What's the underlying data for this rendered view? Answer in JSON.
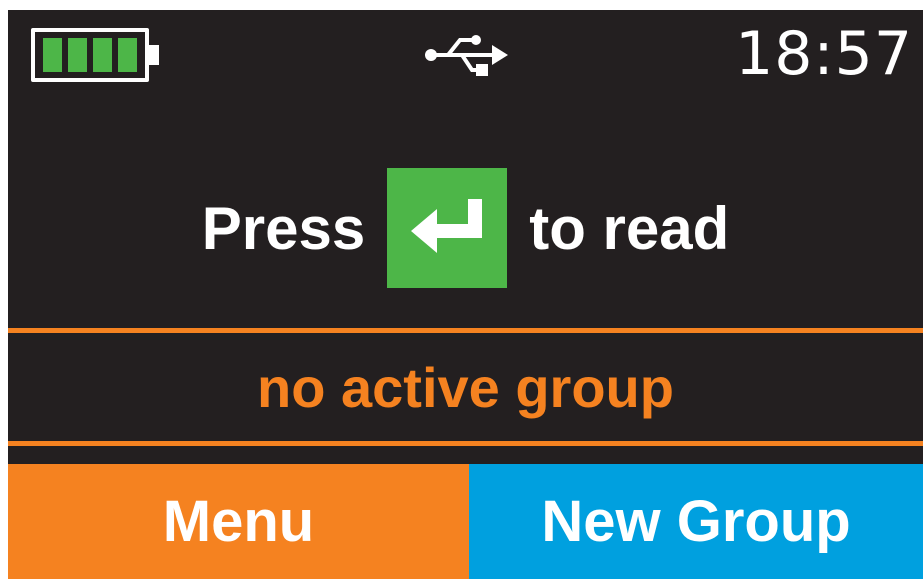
{
  "status_bar": {
    "battery_level": 1.0,
    "battery_icon": "battery-full-icon",
    "connection_icon": "usb-icon",
    "time": "18:57"
  },
  "prompt": {
    "before": "Press",
    "key_icon": "enter-key-icon",
    "after": "to read"
  },
  "group_status": "no active group",
  "softkeys": {
    "left_label": "Menu",
    "right_label": "New Group"
  },
  "colors": {
    "background": "#231f20",
    "battery_green": "#4db648",
    "enter_green": "#4db648",
    "accent_orange": "#f58220",
    "accent_blue": "#00a0df",
    "text": "#ffffff"
  }
}
